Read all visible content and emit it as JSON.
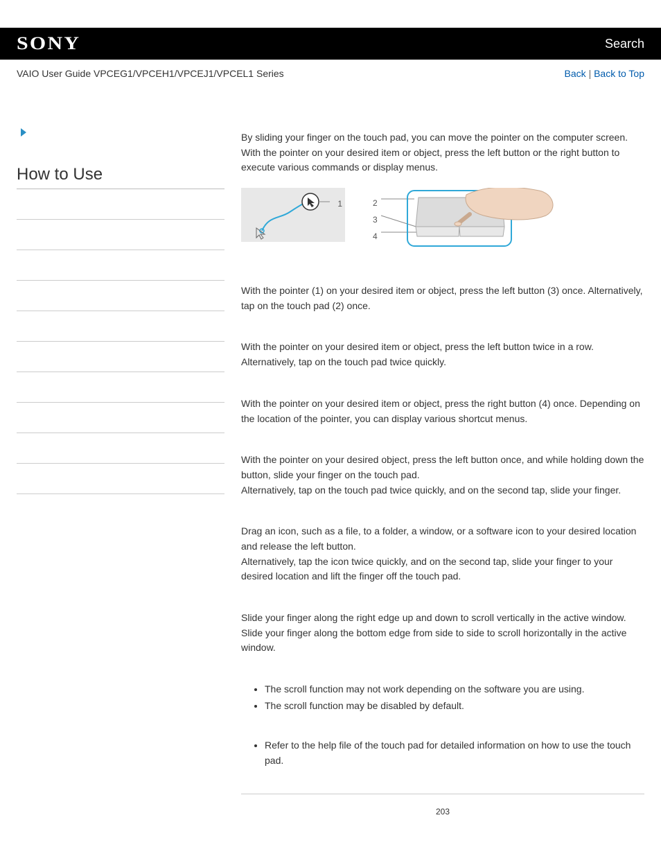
{
  "header": {
    "brand": "SONY",
    "search": "Search"
  },
  "subheader": {
    "title": "VAIO User Guide VPCEG1/VPCEH1/VPCEJ1/VPCEL1 Series",
    "back": "Back",
    "back_to_top": "Back to Top"
  },
  "sidebar": {
    "heading": "How to Use"
  },
  "content": {
    "intro": "By sliding your finger on the touch pad, you can move the pointer on the computer screen. With the pointer on your desired item or object, press the left button or the right button to execute various commands or display menus.",
    "callouts": {
      "d1": "1",
      "d2": "2",
      "d3": "3",
      "d4": "4"
    },
    "p1": "With the pointer (1) on your desired item or object, press the left button (3) once. Alternatively, tap on the touch pad (2) once.",
    "p2": "With the pointer on your desired item or object, press the left button twice in a row. Alternatively, tap on the touch pad twice quickly.",
    "p3": "With the pointer on your desired item or object, press the right button (4) once. Depending on the location of the pointer, you can display various shortcut menus.",
    "p4": "With the pointer on your desired object, press the left button once, and while holding down the button, slide your finger on the touch pad.\nAlternatively, tap on the touch pad twice quickly, and on the second tap, slide your finger.",
    "p5": "Drag an icon, such as a file, to a folder, a window, or a software icon to your desired location and release the left button.\nAlternatively, tap the icon twice quickly, and on the second tap, slide your finger to your desired location and lift the finger off the touch pad.",
    "p6": "Slide your finger along the right edge up and down to scroll vertically in the active window. Slide your finger along the bottom edge from side to side to scroll horizontally in the active window.",
    "notes1": [
      "The scroll function may not work depending on the software you are using.",
      "The scroll function may be disabled by default."
    ],
    "notes2": [
      "Refer to the help file of the touch pad for detailed information on how to use the touch pad."
    ]
  },
  "page_number": "203"
}
